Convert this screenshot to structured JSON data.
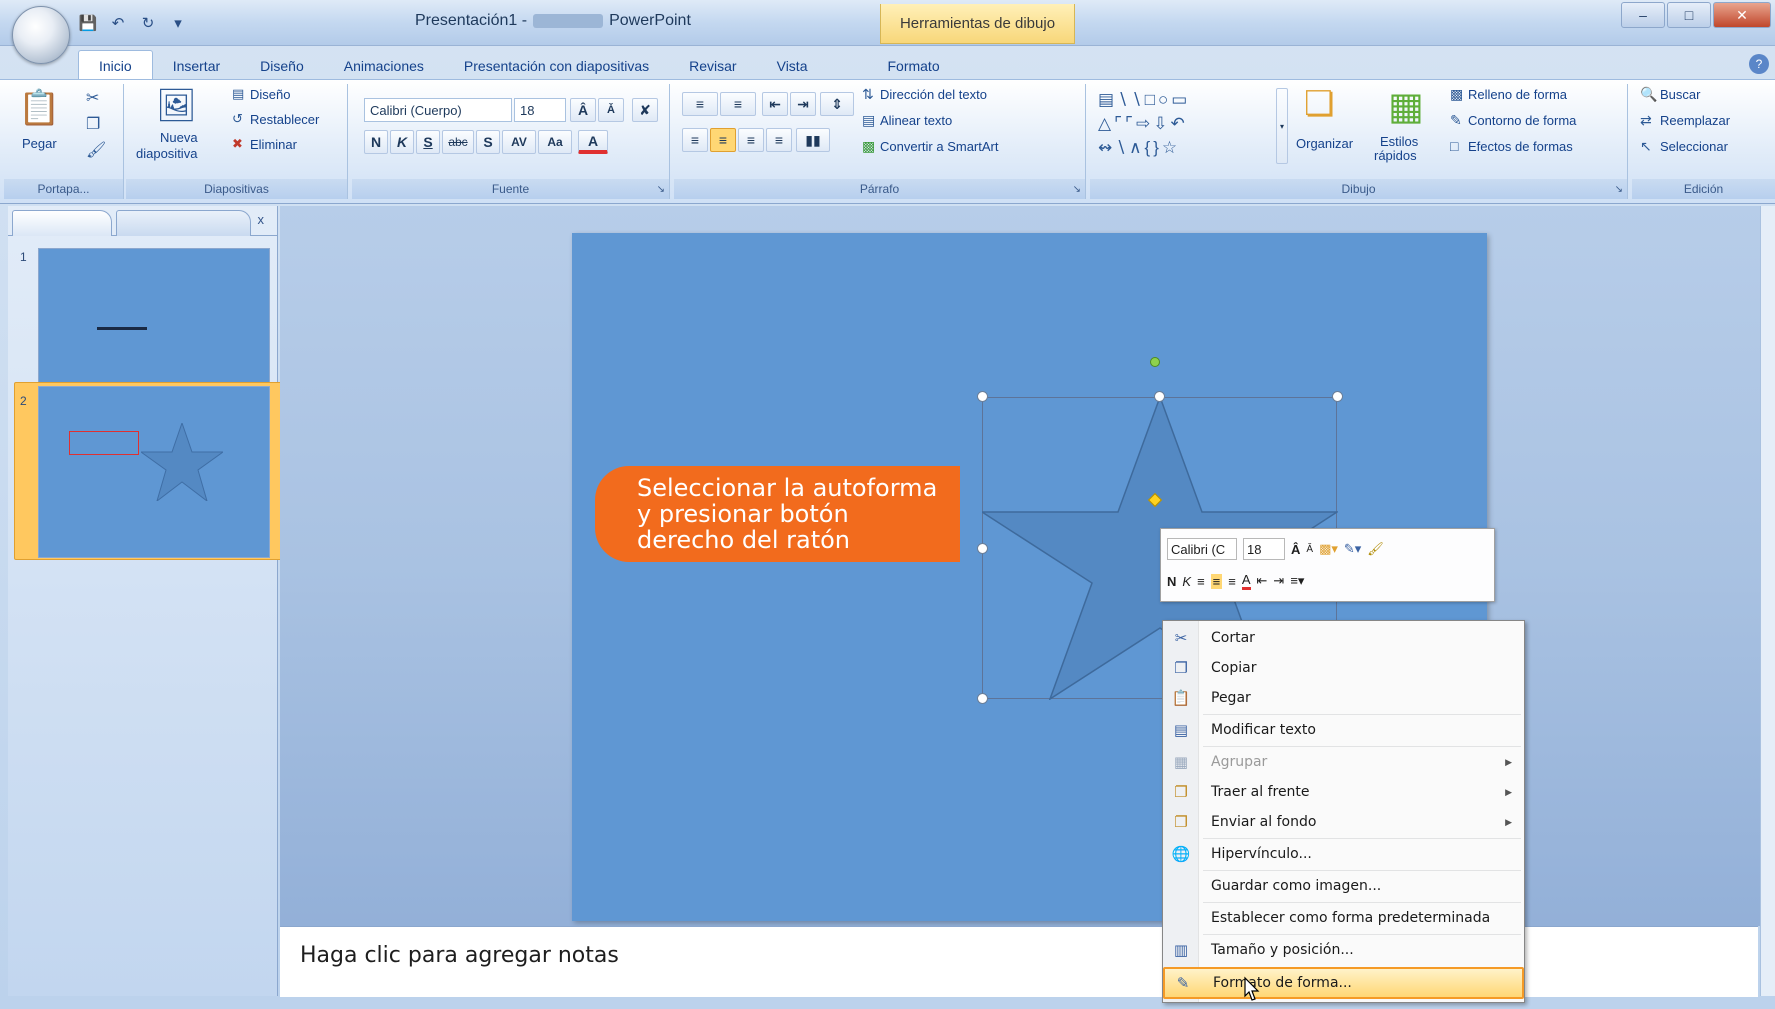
{
  "window": {
    "title_doc": "Presentación1 -",
    "title_app": "PowerPoint",
    "contextual_tools": "Herramientas de dibujo"
  },
  "quick_access": {
    "icons": [
      "save-icon",
      "undo-icon",
      "redo-icon",
      "customize-icon"
    ]
  },
  "tabs": [
    "Inicio",
    "Insertar",
    "Diseño",
    "Animaciones",
    "Presentación con diapositivas",
    "Revisar",
    "Vista",
    "Formato"
  ],
  "ribbon": {
    "clipboard": {
      "paste": "Pegar",
      "label": "Portapa..."
    },
    "slides": {
      "new_slide_line1": "Nueva",
      "new_slide_line2": "diapositiva",
      "layout": "Diseño",
      "reset": "Restablecer",
      "delete": "Eliminar",
      "label": "Diapositivas"
    },
    "font": {
      "font_name": "Calibri (Cuerpo)",
      "font_size": "18",
      "bold": "N",
      "italic": "K",
      "underline": "S",
      "strike": "abc",
      "shadow": "S",
      "spacing": "AV",
      "case": "Aa",
      "color": "A",
      "label": "Fuente"
    },
    "paragraph": {
      "text_direction": "Dirección del texto",
      "align_text": "Alinear texto",
      "convert_smartart": "Convertir a SmartArt",
      "label": "Párrafo"
    },
    "drawing": {
      "arrange": "Organizar",
      "quick_styles_line1": "Estilos",
      "quick_styles_line2": "rápidos",
      "shape_fill": "Relleno de forma",
      "shape_outline": "Contorno de forma",
      "shape_effects": "Efectos de formas",
      "label": "Dibujo"
    },
    "editing": {
      "find": "Buscar",
      "replace": "Reemplazar",
      "select": "Seleccionar",
      "label": "Edición"
    }
  },
  "slides_panel": {
    "close": "x",
    "thumbs": [
      {
        "number": "1"
      },
      {
        "number": "2"
      }
    ]
  },
  "slide": {
    "callout_text": "Seleccionar la autoforma\ny presionar botón\nderecho del ratón"
  },
  "notes": {
    "placeholder": "Haga clic para agregar notas"
  },
  "mini_toolbar": {
    "font": "Calibri (C",
    "size": "18",
    "bold": "N",
    "italic": "K"
  },
  "context_menu": {
    "items": [
      {
        "label": "Cortar",
        "icon": "scissors-icon",
        "enabled": true
      },
      {
        "label": "Copiar",
        "icon": "copy-icon",
        "enabled": true
      },
      {
        "label": "Pegar",
        "icon": "paste-icon",
        "enabled": true
      },
      {
        "label": "Modificar texto",
        "icon": "edit-text-icon",
        "enabled": true
      },
      {
        "label": "Agrupar",
        "icon": "group-icon",
        "enabled": false
      },
      {
        "label": "Traer al frente",
        "icon": "bring-front-icon",
        "enabled": true
      },
      {
        "label": "Enviar al fondo",
        "icon": "send-back-icon",
        "enabled": true
      },
      {
        "label": "Hipervínculo...",
        "icon": "hyperlink-icon",
        "enabled": true
      },
      {
        "label": "Guardar como imagen...",
        "icon": "",
        "enabled": true
      },
      {
        "label": "Establecer como forma predeterminada",
        "icon": "",
        "enabled": true
      },
      {
        "label": "Tamaño y posición...",
        "icon": "size-position-icon",
        "enabled": true
      },
      {
        "label": "Formato de forma...",
        "icon": "format-shape-icon",
        "enabled": true,
        "highlighted": true
      }
    ]
  },
  "colors": {
    "slide_bg": "#5f97d3",
    "callout": "#f26b1d",
    "selection_highlight": "#ffd774"
  }
}
